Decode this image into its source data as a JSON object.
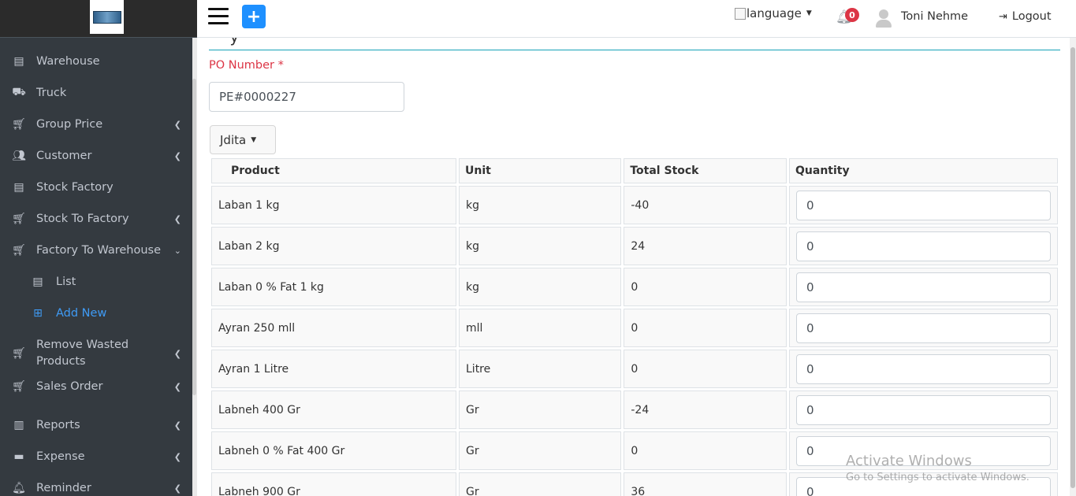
{
  "sidebar": {
    "items": [
      {
        "label": "Warehouse",
        "icon": "list-icon",
        "chevron": false
      },
      {
        "label": "Truck",
        "icon": "truck-icon",
        "chevron": false
      },
      {
        "label": "Group Price",
        "icon": "cart-icon",
        "chevron": "left"
      },
      {
        "label": "Customer",
        "icon": "users-icon",
        "chevron": "left"
      },
      {
        "label": "Stock Factory",
        "icon": "list-icon",
        "chevron": false
      },
      {
        "label": "Stock To Factory",
        "icon": "cart-icon",
        "chevron": "left"
      },
      {
        "label": "Factory To Warehouse",
        "icon": "cart-icon",
        "chevron": "down"
      },
      {
        "label": "List",
        "icon": "list-icon",
        "sub": true
      },
      {
        "label": "Add New",
        "icon": "plus-square-icon",
        "sub": true,
        "active": true
      },
      {
        "label": "Remove Wasted Products",
        "icon": "cart-icon",
        "chevron": "left"
      },
      {
        "label": "Sales Order",
        "icon": "cart-icon",
        "chevron": "left"
      },
      {
        "label": "Reports",
        "icon": "chart-icon",
        "chevron": "left"
      },
      {
        "label": "Expense",
        "icon": "wallet-icon",
        "chevron": "left"
      },
      {
        "label": "Reminder",
        "icon": "bell-icon",
        "chevron": "left"
      }
    ]
  },
  "topbar": {
    "language_alt": "language",
    "notification_count": "0",
    "username": "Toni Nehme",
    "logout_label": "Logout"
  },
  "form": {
    "po_label": "PO Number *",
    "po_value": "PE#0000227",
    "dropdown_label": "Jdita"
  },
  "table": {
    "headers": [
      "Product",
      "Unit",
      "Total Stock",
      "Quantity"
    ],
    "rows": [
      {
        "product": "Laban 1 kg",
        "unit": "kg",
        "stock": "-40",
        "qty": "0"
      },
      {
        "product": "Laban 2 kg",
        "unit": "kg",
        "stock": "24",
        "qty": "0"
      },
      {
        "product": "Laban 0 % Fat 1 kg",
        "unit": "kg",
        "stock": "0",
        "qty": "0"
      },
      {
        "product": "Ayran 250 mll",
        "unit": "mll",
        "stock": "0",
        "qty": "0"
      },
      {
        "product": "Ayran 1 Litre",
        "unit": "Litre",
        "stock": "0",
        "qty": "0"
      },
      {
        "product": "Labneh 400 Gr",
        "unit": "Gr",
        "stock": "-24",
        "qty": "0"
      },
      {
        "product": "Labneh 0 % Fat 400 Gr",
        "unit": "Gr",
        "stock": "0",
        "qty": "0"
      },
      {
        "product": "Labneh 900 Gr",
        "unit": "Gr",
        "stock": "36",
        "qty": "0"
      }
    ]
  },
  "watermark": {
    "line1": "Activate Windows",
    "line2": "Go to Settings to activate Windows."
  },
  "colors": {
    "sidebar_bg": "#343a40",
    "accent": "#1e90ff",
    "required": "#dc3545",
    "active_link": "#3f9bf5"
  }
}
